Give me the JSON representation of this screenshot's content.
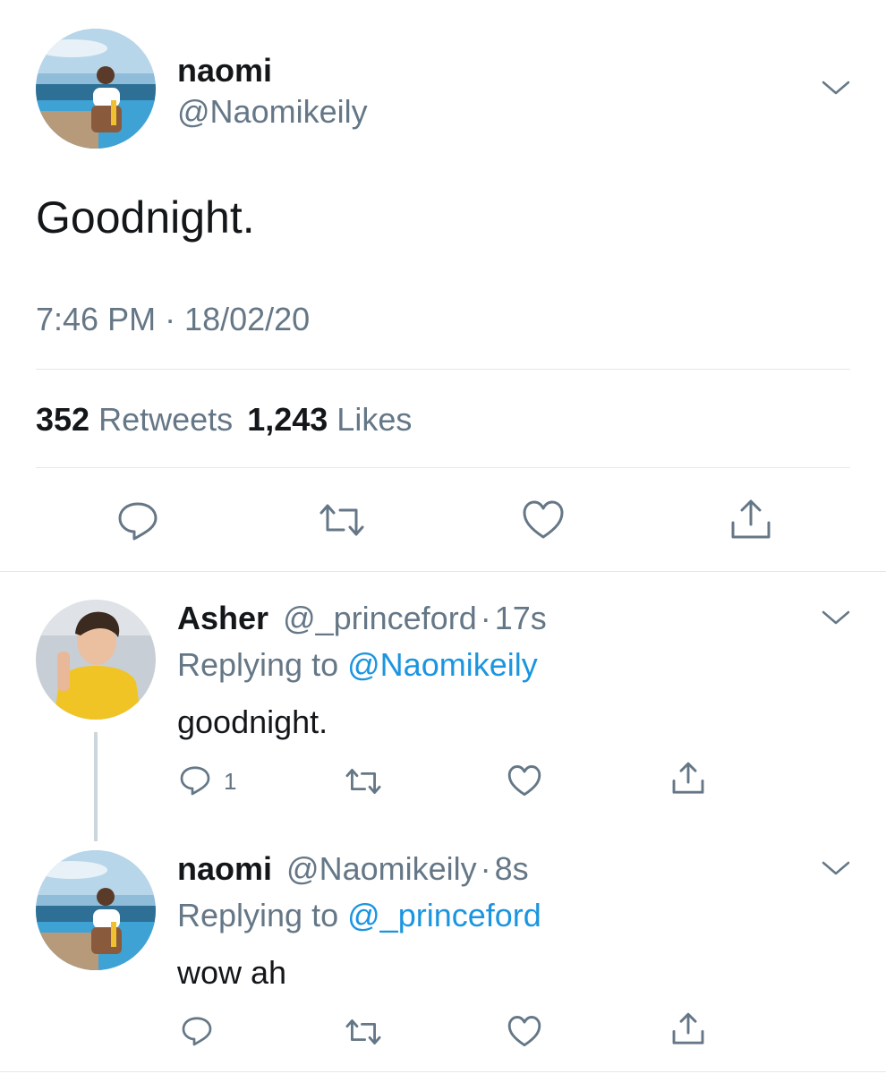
{
  "main_tweet": {
    "display_name": "naomi",
    "handle": "@Naomikeily",
    "text": "Goodnight.",
    "timestamp": "7:46 PM · 18/02/20",
    "retweet_count": "352",
    "retweet_label": "Retweets",
    "like_count": "1,243",
    "like_label": "Likes"
  },
  "replies": [
    {
      "display_name": "Asher",
      "handle": "@_princeford",
      "separator": "·",
      "time": "17s",
      "replying_prefix": "Replying to",
      "replying_to": "@Naomikeily",
      "text": "goodnight.",
      "reply_count": "1"
    },
    {
      "display_name": "naomi",
      "handle": "@Naomikeily",
      "separator": "·",
      "time": "8s",
      "replying_prefix": "Replying to",
      "replying_to": "@_princeford",
      "text": "wow ah",
      "reply_count": ""
    }
  ],
  "icons": [
    "chevron-down-icon",
    "reply-icon",
    "retweet-icon",
    "like-icon",
    "share-icon"
  ],
  "colors": {
    "text": "#14171a",
    "secondary": "#657786",
    "link": "#1b95e0",
    "divider": "#e1e8ed"
  }
}
